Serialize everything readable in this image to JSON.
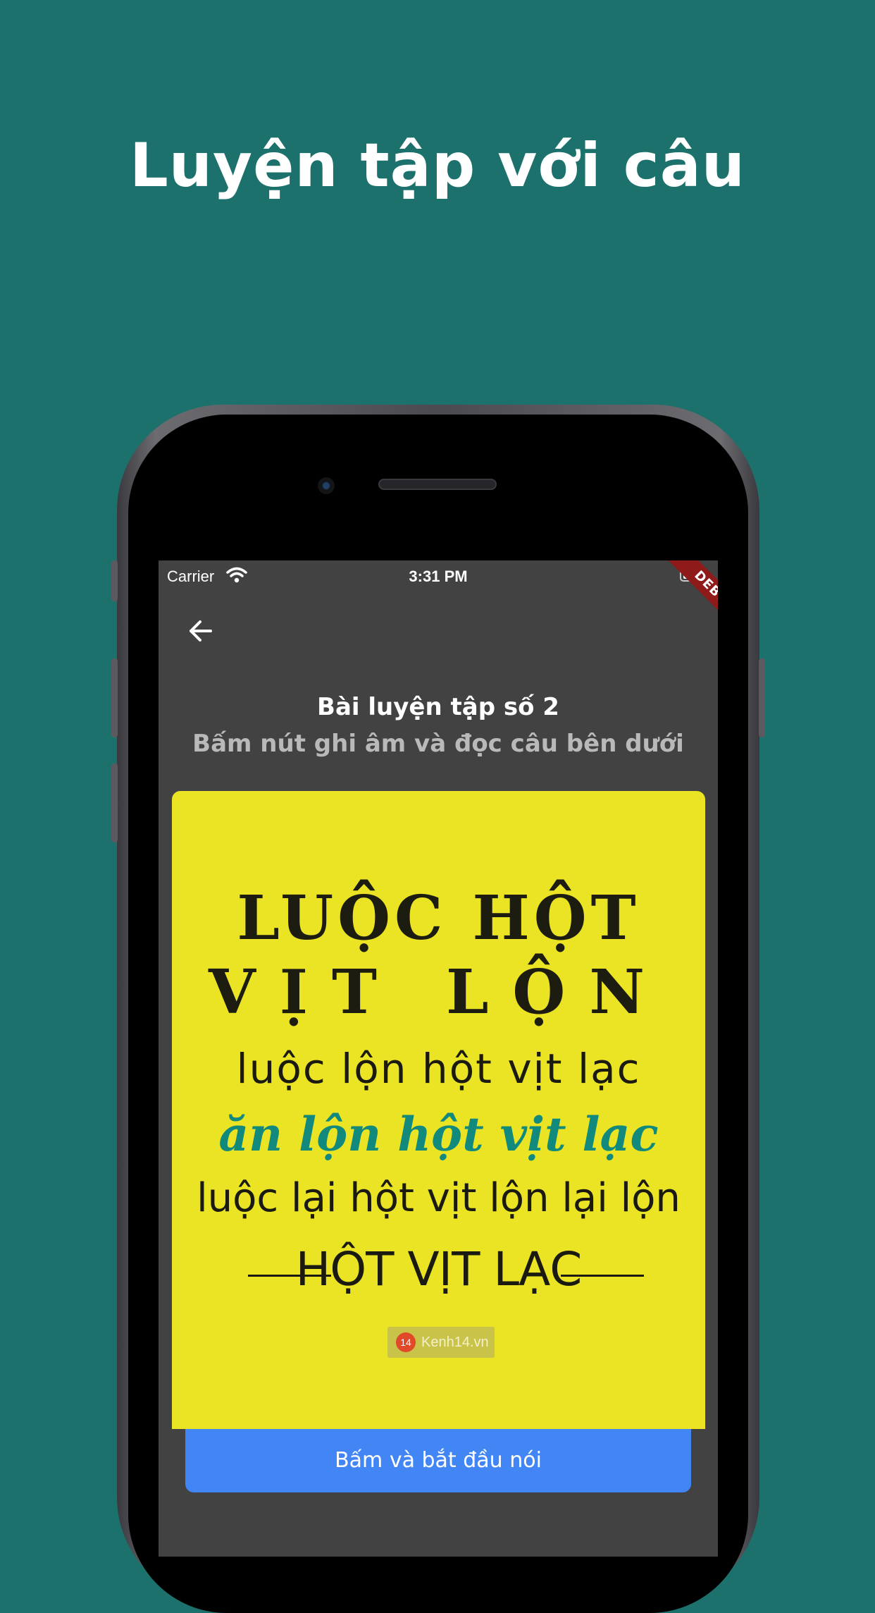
{
  "hero": {
    "title": "Luyện tập với câu"
  },
  "status_bar": {
    "carrier": "Carrier",
    "time": "3:31 PM",
    "debug_label": "DEBUG"
  },
  "lesson": {
    "title": "Bài luyện tập số 2",
    "subtitle": "Bấm nút ghi âm và đọc câu bên dưới"
  },
  "poster": {
    "line1": "LUỘC HỘT",
    "line2": "VỊT LỘN",
    "line3": "luộc lộn hột vịt lạc",
    "line4": "ăn lộn hột vịt lạc",
    "line5": "luộc lại hột vịt lộn lại lộn",
    "line6": "HỘT VỊT LẠC",
    "watermark": "Kenh14.vn",
    "watermark_badge": "14"
  },
  "action": {
    "speak_button_label": "Bấm và bắt đầu nói"
  },
  "colors": {
    "background": "#1c716d",
    "screen": "#424242",
    "card": "#ebe424",
    "accent_button": "#4286f5",
    "poster_green": "#118a7d"
  },
  "icons": [
    "back-arrow-icon",
    "wifi-icon",
    "battery-icon",
    "kenh14-logo-icon"
  ]
}
